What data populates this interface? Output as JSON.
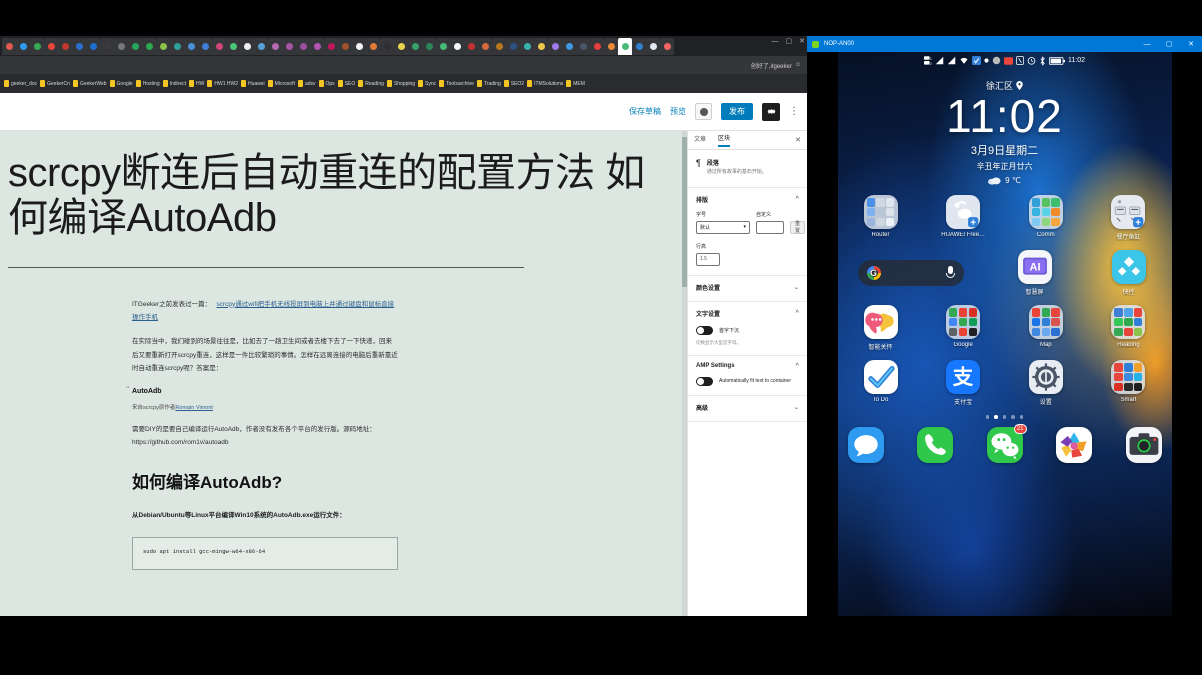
{
  "browser": {
    "window_controls": [
      "—",
      "▢",
      "✕"
    ],
    "account_label": "创好了,itgeeker",
    "bookmarks": [
      "geeker_doc",
      "GeekerCn",
      "GeekerWeb",
      "Google",
      "Hosting",
      "Indirect",
      "HW",
      "HW1 HW2",
      "Huawei",
      "Microsoft",
      "adsv",
      "Ops",
      "SEO",
      "Reading",
      "Shopping",
      "Sync",
      "Toolsarchive",
      "Trading",
      "SEO2",
      "ITMSolutions",
      "MEM"
    ],
    "tab_count": 48
  },
  "editor": {
    "toolbar": {
      "save_draft": "保存草稿",
      "preview": "预览",
      "preview_icon": "eye-icon",
      "publish": "发布",
      "settings_icon": "gear-icon",
      "more_icon": "kebab-menu-icon"
    },
    "post": {
      "title": "scrcpy断连后自动重连的配置方法 如何编译AutoAdb",
      "paragraph_1_pre": "ITGeeker之前发表过一篇：",
      "paragraph_1_link": "scrcpy通过wifi把手机无线投屏到电脑上并通过键盘和鼠标直接操作手机",
      "paragraph_2": "在实际当中，我们碰到的场景往往是，比如去了一趟卫生间或者去楼下去了一下快递，回来后又要重新打开scrcpy重连，这样是一件比较繁琐的事情。怎样在远离连接的电脑后重新靠近时自动重连scrcpy呢？答案是：",
      "heading_autoadb": "AutoAdb",
      "credit_pre": "来自scrcpy原作者",
      "credit_link": "Romain Vimont",
      "paragraph_3": "需要DIY的是要自己编译运行AutoAdb，作者没有发布各个平台的发行版。源码地址：https://github.com/rom1v/autoadb",
      "heading_howto": "如何编译AutoAdb?",
      "lead": "从Debian/Ubuntu等Linux平台编译Win10系统的AutoAdb.exe运行文件：",
      "code": "sudo apt install gcc-mingw-w64-x86-64"
    },
    "sidebar": {
      "tab_post": "文章",
      "tab_block": "区块",
      "close_icon": "close-icon",
      "block_icon": "paragraph-pilcrow-icon",
      "block_title": "段落",
      "block_desc": "通过所有故事的基石开始。",
      "panels": {
        "typography": {
          "title": "排版",
          "font_size_label": "字号",
          "font_size_value": "默认",
          "custom_label": "自定义",
          "custom_value": "",
          "reset_label": "重置",
          "line_height_label": "行高",
          "line_height_value": "1.5"
        },
        "color": {
          "title": "颜色设置"
        },
        "text": {
          "title": "文字设置",
          "dropcap_label": "首字下沉",
          "dropcap_hint": "切换显示大型首字母。",
          "dropcap_on": false
        },
        "amp": {
          "title": "AMP Settings",
          "fit_text_label": "Automatically fit text to container",
          "fit_text_on": false
        },
        "advanced": {
          "title": "高级"
        }
      }
    }
  },
  "phone": {
    "window_title": "NOP-AN00",
    "window_controls": [
      "—",
      "▢",
      "✕"
    ],
    "statusbar": {
      "time": "11:02",
      "icons": [
        "dual-sim-icon",
        "signal-icon",
        "signal-icon",
        "wifi-icon",
        "vpn-icon",
        "dot-icon",
        "mute-icon",
        "record-icon",
        "nfc-icon",
        "alarm-icon",
        "bluetooth-icon",
        "battery-icon"
      ]
    },
    "clock_widget": {
      "location": "徐汇区",
      "location_icon": "location-pin-icon",
      "time": "11:02",
      "date": "3月9日星期二",
      "lunar": "辛丑年正月廿六",
      "weather_icon": "cloud-icon",
      "temperature": "9 ℃"
    },
    "search_widget": {
      "logo_icon": "google-g-icon",
      "mic_icon": "microphone-icon"
    },
    "rows": [
      [
        {
          "label": "Router",
          "type": "folder",
          "colors": [
            "#4a8fe8",
            "#cfd8e3",
            "#e0e6ee",
            "#7fb0ef",
            "#b9c6d6",
            "#dde3ea",
            "#9bb6dd",
            "#cdd6e1",
            "#eef2f6"
          ]
        },
        {
          "label": "HUAWEI Free…",
          "type": "app",
          "bg": "#dfe6ef",
          "glyph": "earbuds-icon"
        },
        {
          "label": "Comm",
          "type": "folder",
          "colors": [
            "#34a0d8",
            "#57c25f",
            "#3ebf6d",
            "#33b3e0",
            "#5ad3e6",
            "#f08a2a",
            "#7ec9f2",
            "#8fd67c",
            "#f6a63c"
          ]
        },
        {
          "label": "餐厅鱼缸",
          "type": "app",
          "bg": "#e6eaf0",
          "glyph": "aquarium-controller-icon"
        }
      ],
      [
        {
          "label": "",
          "type": "widget",
          "glyph": "google-search-widget"
        },
        {
          "label": "智慧屏",
          "type": "app",
          "bg": "#f4f6f9",
          "glyph": "smart-tv-ai-icon"
        },
        {
          "label": "快控",
          "type": "app",
          "bg": "#3bc5e8",
          "glyph": "quick-control-icon"
        }
      ],
      [
        {
          "label": "智能关怀",
          "type": "app",
          "bg": "#ffffff",
          "glyph": "smart-care-icon"
        },
        {
          "label": "Google",
          "type": "folder",
          "colors": [
            "#34a853",
            "#ea4335",
            "#d93025",
            "#4285f4",
            "#34a853",
            "#0f9d58",
            "#5f6368",
            "#ea4335",
            "#202124"
          ]
        },
        {
          "label": "Map",
          "type": "folder",
          "colors": [
            "#ea4335",
            "#34a853",
            "#e8453c",
            "#1a73e8",
            "#2f7fd8",
            "#d9534f",
            "#3f8ae0",
            "#6aa8f0",
            "#2b6fd0"
          ]
        },
        {
          "label": "Reading",
          "type": "folder",
          "colors": [
            "#3f7fd6",
            "#4fa3e8",
            "#e8453c",
            "#34c759",
            "#2fa84f",
            "#2f7fd8",
            "#34a853",
            "#e8453c",
            "#8bc34a"
          ]
        }
      ],
      [
        {
          "label": "To Do",
          "type": "app",
          "bg": "#ffffff",
          "glyph": "todo-check-icon"
        },
        {
          "label": "支付宝",
          "type": "app",
          "bg": "#1677ff",
          "glyph": "alipay-icon"
        },
        {
          "label": "设置",
          "type": "app",
          "bg": "#e8ecf3",
          "glyph": "settings-gear-icon"
        },
        {
          "label": "Smart",
          "type": "folder",
          "colors": [
            "#e8453c",
            "#2f7fd8",
            "#f0a02a",
            "#e8453c",
            "#3f8ae0",
            "#25b0e8",
            "#d93025",
            "#2b2b2b",
            "#1f1f1f"
          ]
        }
      ]
    ],
    "page_dots": {
      "count": 5,
      "active_index": 1
    },
    "dock": [
      {
        "name": "messages",
        "label": "",
        "bg": "#2e9bf0",
        "glyph": "speech-bubble-icon",
        "badge": ""
      },
      {
        "name": "phone",
        "label": "",
        "bg": "#2fc84b",
        "glyph": "phone-handset-icon",
        "badge": ""
      },
      {
        "name": "wechat",
        "label": "",
        "bg": "#2fc84b",
        "glyph": "wechat-icon",
        "badge": "21"
      },
      {
        "name": "gallery",
        "label": "",
        "bg": "#ffffff",
        "glyph": "gallery-flower-icon",
        "badge": ""
      },
      {
        "name": "camera",
        "label": "",
        "bg": "#f2f4f7",
        "glyph": "camera-icon",
        "badge": ""
      }
    ]
  }
}
